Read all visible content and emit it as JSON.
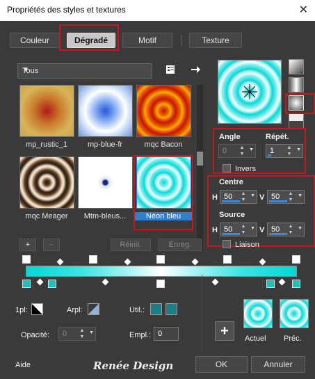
{
  "window": {
    "title": "Propriétés des styles et textures",
    "close_glyph": "✕"
  },
  "tabs": [
    {
      "label": "Couleur"
    },
    {
      "label": "Dégradé"
    },
    {
      "label": "Motif"
    },
    {
      "label": "Texture"
    }
  ],
  "preset_combo": {
    "value": "Tous"
  },
  "swatches": [
    {
      "label": "mp_rustic_1"
    },
    {
      "label": "mp-blue-fr"
    },
    {
      "label": "mqc Bacon"
    },
    {
      "label": "mqc Meager"
    },
    {
      "label": "Mtm-bleus..."
    },
    {
      "label": "Néon bleu"
    }
  ],
  "list_buttons": {
    "add": "+",
    "remove": "-",
    "reset": "Réinit.",
    "save": "Enreg."
  },
  "angle": {
    "label": "Angle",
    "value": "0"
  },
  "repeat": {
    "label": "Répét.",
    "value": "1"
  },
  "invert": {
    "label": "Invers"
  },
  "centre": {
    "label": "Centre",
    "h_label": "H",
    "h_value": "50",
    "v_label": "V",
    "v_value": "50"
  },
  "source": {
    "label": "Source",
    "h_label": "H",
    "h_value": "50",
    "v_label": "V",
    "v_value": "50"
  },
  "link": {
    "label": "Liaison"
  },
  "stop_props": {
    "opacity_label": "1pl:",
    "arpl_label": "Arpl:",
    "util_label": "Util.:",
    "opacite_label": "Opacité:",
    "opacite_value": "0",
    "empl_label": "Empl.:",
    "empl_value": "0"
  },
  "current": {
    "label": "Actuel"
  },
  "previous": {
    "label": "Préc."
  },
  "footer": {
    "help": "Aide",
    "logo": "Renée Design",
    "ok": "OK",
    "cancel": "Annuler"
  },
  "colors": {
    "accent_red": "#c8161d",
    "neon": "#00e0e0",
    "selection": "#2f7fd0"
  }
}
